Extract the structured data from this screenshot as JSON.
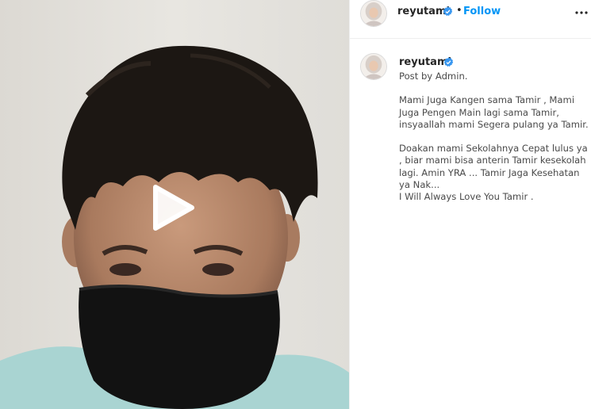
{
  "post": {
    "username": "reyutami",
    "separator": "•",
    "follow_label": "Follow",
    "caption": "Post by Admin.\n\nMami Juga Kangen sama Tamir , Mami Juga Pengen Main lagi sama Tamir, insyaallah mami Segera pulang ya Tamir.\n\nDoakan mami Sekolahnya Cepat lulus ya , biar mami bisa anterin Tamir kesekolah lagi. Amin YRA ... Tamir Jaga Kesehatan ya Nak...\nI Will Always Love You Tamir ."
  },
  "colors": {
    "follow": "#0095f6",
    "verified": "#3897f0",
    "username": "#262626",
    "caption_text": "#4a4a4a",
    "divider": "#efefef"
  },
  "icons": {
    "play": "play-icon",
    "verified": "verified-badge-icon",
    "more": "more-options-icon"
  }
}
